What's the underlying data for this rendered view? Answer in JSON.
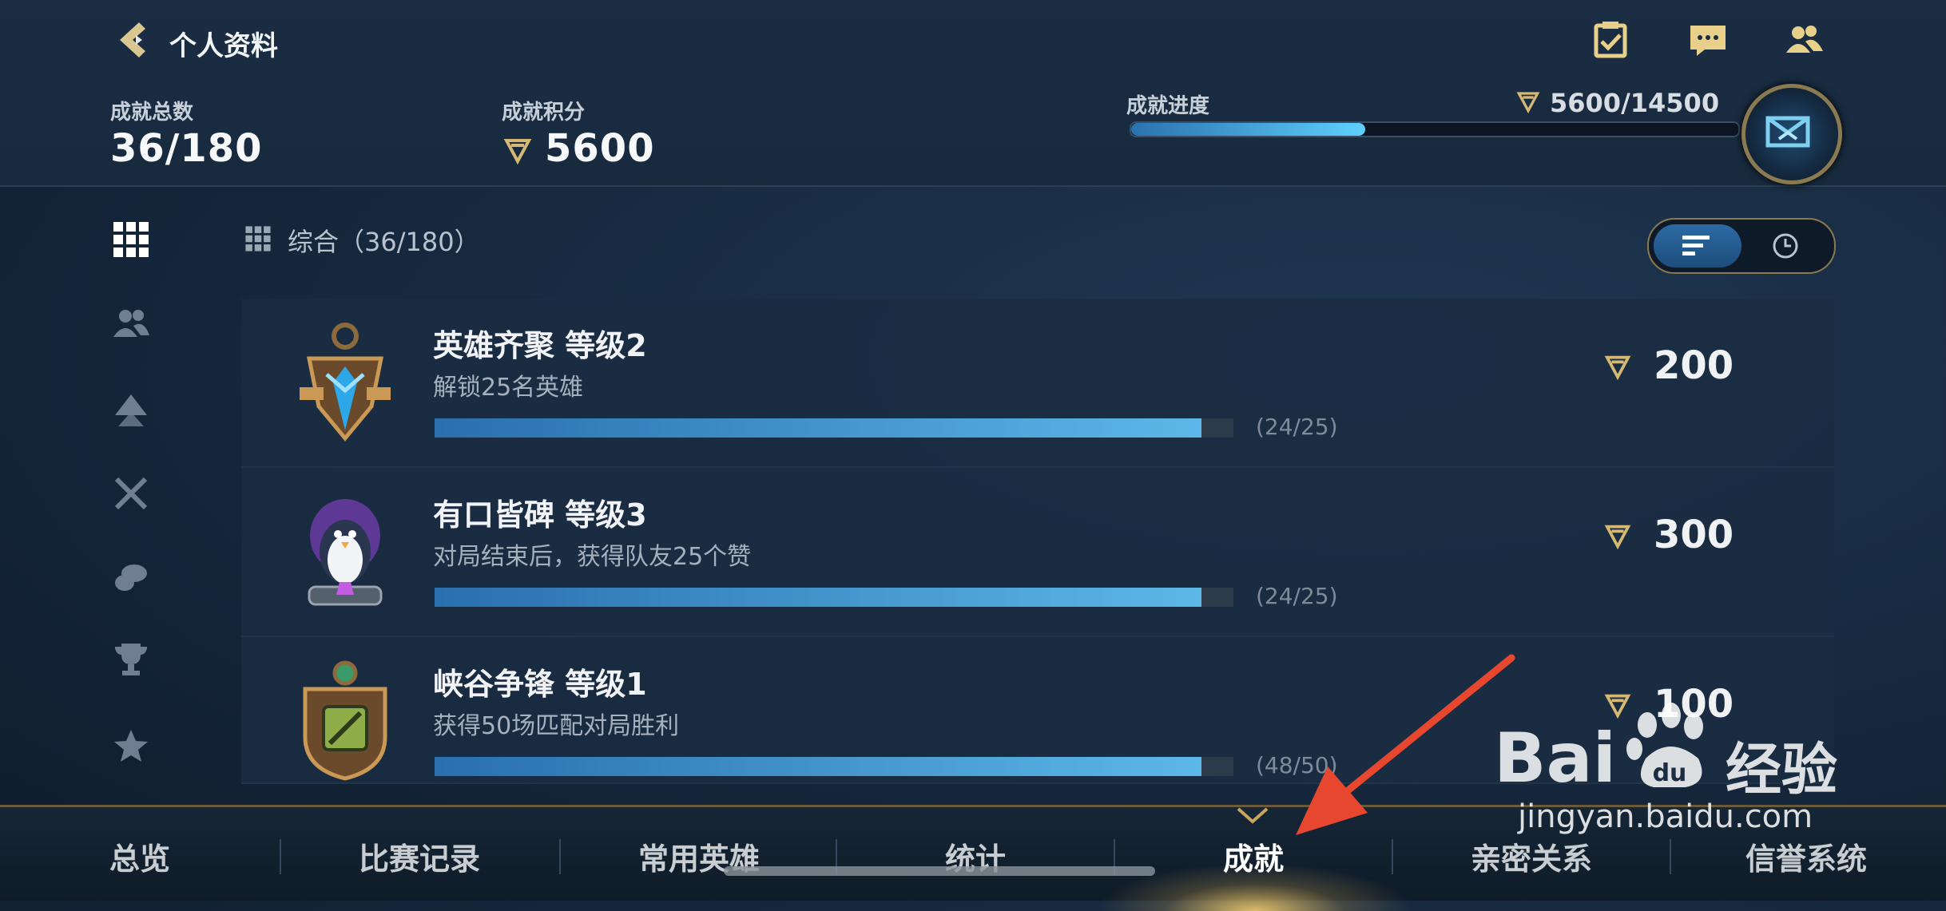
{
  "header": {
    "title": "个人资料",
    "stats": {
      "total_label": "成就总数",
      "total_value": "36/180",
      "points_label": "成就积分",
      "points_value": "5600",
      "progress_label": "成就进度",
      "progress_value": "5600/14500",
      "progress_fraction": 0.386
    }
  },
  "icons": {
    "top": [
      "clipboard-check-icon",
      "chat-bubble-icon",
      "friends-icon"
    ],
    "rail": [
      "grid-icon",
      "people-icon",
      "rank-icon",
      "crossed-swords-icon",
      "hand-icon",
      "trophy-icon",
      "star-icon"
    ]
  },
  "category": {
    "label": "综合（36/180）"
  },
  "achievements": [
    {
      "name": "英雄齐聚 等级2",
      "desc": "解锁25名英雄",
      "count": "(24/25)",
      "fraction": 0.96,
      "reward": "200"
    },
    {
      "name": "有口皆碑 等级3",
      "desc": "对局结束后，获得队友25个赞",
      "count": "(24/25)",
      "fraction": 0.96,
      "reward": "300"
    },
    {
      "name": "峡谷争锋 等级1",
      "desc": "获得50场匹配对局胜利",
      "count": "(48/50)",
      "fraction": 0.96,
      "reward": "100"
    }
  ],
  "bottom_nav": {
    "items": [
      "总览",
      "比赛记录",
      "常用英雄",
      "统计",
      "成就",
      "亲密关系",
      "信誉系统"
    ],
    "active": "成就"
  },
  "watermark": {
    "brand": "Bai",
    "brand2": "经验",
    "url": "jingyan.baidu.com"
  },
  "colors": {
    "accent_blue": "#5fd0ff",
    "gold": "#c9a45a",
    "arrow_red": "#e8472f"
  }
}
